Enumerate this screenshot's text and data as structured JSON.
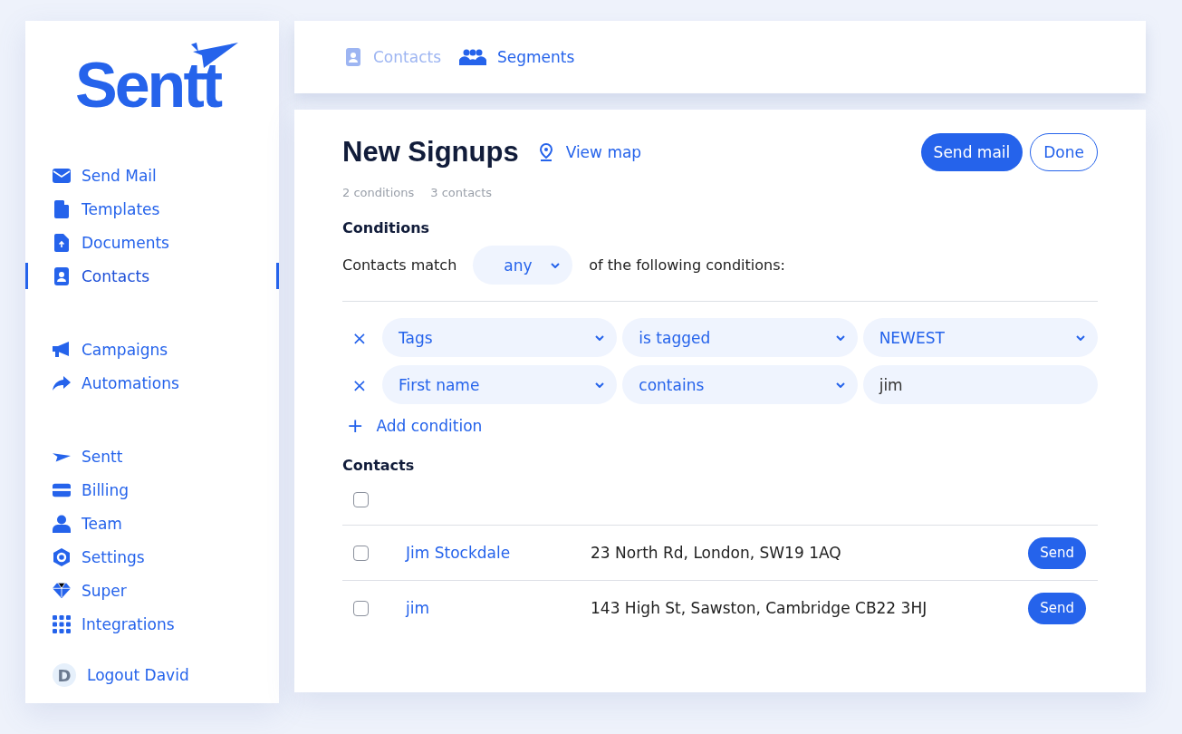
{
  "sidebar": {
    "logo": "Sentt",
    "groups": [
      {
        "items": [
          {
            "label": "Send Mail",
            "selected": false
          },
          {
            "label": "Templates",
            "selected": false
          },
          {
            "label": "Documents",
            "selected": false
          },
          {
            "label": "Contacts",
            "selected": true
          }
        ]
      },
      {
        "items": [
          {
            "label": "Campaigns",
            "selected": false
          },
          {
            "label": "Automations",
            "selected": false
          }
        ]
      },
      {
        "items": [
          {
            "label": "Sentt",
            "selected": false
          },
          {
            "label": "Billing",
            "selected": false
          },
          {
            "label": "Team",
            "selected": false
          },
          {
            "label": "Settings",
            "selected": false
          },
          {
            "label": "Super",
            "selected": false
          },
          {
            "label": "Integrations",
            "selected": false
          }
        ]
      }
    ],
    "user": {
      "initial": "D",
      "label": "Logout David"
    }
  },
  "tabs": [
    {
      "label": "Contacts",
      "selected": false
    },
    {
      "label": "Segments",
      "selected": true
    }
  ],
  "segment": {
    "title": "New Signups",
    "view_map": "View map",
    "buttons": {
      "primary": "Send mail",
      "secondary": "Done"
    },
    "stats": [
      "2 conditions",
      "3 contacts"
    ],
    "conditions_heading": "Conditions",
    "match_prefix": "Contacts match",
    "match_value": "any",
    "match_suffix": "of the following conditions:",
    "conditions": [
      {
        "remove": "×",
        "field": "Tags",
        "operator": "is tagged",
        "value": "NEWEST",
        "kind": "select"
      },
      {
        "remove": "×",
        "field": "First name",
        "operator": "contains",
        "value": "jim",
        "kind": "input"
      }
    ],
    "add_condition": {
      "icon": "+",
      "label": "Add condition"
    },
    "contacts_heading": "Contacts",
    "select_all": {
      "checked": false
    },
    "contacts": [
      {
        "name": "Jim Stockdale",
        "address": "23 North Rd, London, SW19 1AQ",
        "checked": false,
        "action": "Send"
      },
      {
        "name": "jim",
        "address": "143 High St, Sawston, Cambridge CB22 3HJ",
        "checked": false,
        "action": "Send"
      }
    ]
  }
}
